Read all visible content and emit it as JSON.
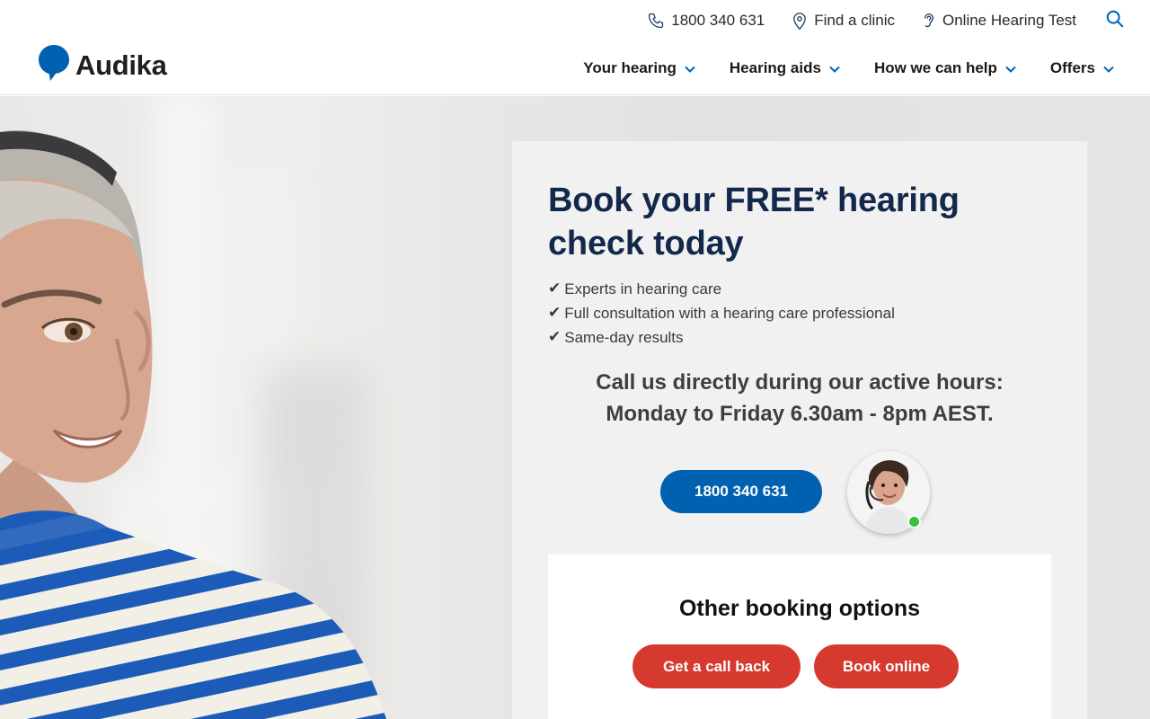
{
  "header": {
    "phone": "1800 340 631",
    "find_clinic": "Find a clinic",
    "online_test": "Online Hearing Test",
    "logo_text": "Audika",
    "nav": [
      {
        "label": "Your hearing"
      },
      {
        "label": "Hearing aids"
      },
      {
        "label": "How we can help"
      },
      {
        "label": "Offers"
      }
    ]
  },
  "booking": {
    "title": "Book your FREE* hearing check today",
    "benefits": [
      "Experts in hearing care",
      "Full consultation with a hearing care professional",
      "Same-day results"
    ],
    "check_glyph": "✔",
    "call_line1": "Call us directly during our active hours:",
    "call_line2": "Monday to Friday 6.30am - 8pm AEST.",
    "phone_button": "1800 340 631",
    "other_title": "Other booking options",
    "callback_button": "Get a call back",
    "online_button": "Book online"
  },
  "colors": {
    "brand_blue": "#0061b0",
    "title_navy": "#13294b",
    "cta_red": "#d63a2f",
    "online_green": "#36c43a"
  },
  "icons": [
    "phone-icon",
    "map-pin-icon",
    "ear-icon",
    "search-icon",
    "chevron-down-icon",
    "logo-speech-bubble-icon"
  ]
}
